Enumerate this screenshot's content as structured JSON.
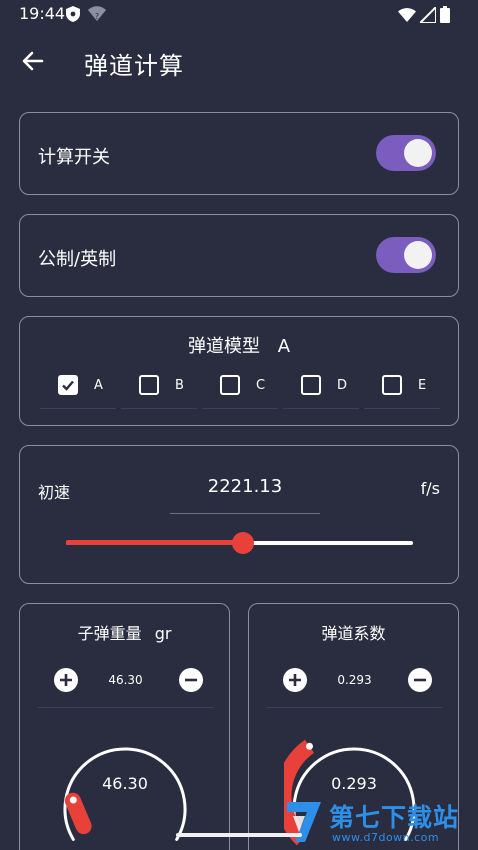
{
  "status": {
    "time": "19:44"
  },
  "header": {
    "title": "弹道计算"
  },
  "calc_switch": {
    "label": "计算开关",
    "on": true
  },
  "unit_switch": {
    "label": "公制/英制",
    "on": true
  },
  "model": {
    "title": "弹道模型",
    "selected": "A",
    "options": [
      {
        "label": "A",
        "checked": true
      },
      {
        "label": "B",
        "checked": false
      },
      {
        "label": "C",
        "checked": false
      },
      {
        "label": "D",
        "checked": false
      },
      {
        "label": "E",
        "checked": false
      }
    ]
  },
  "velocity": {
    "label": "初速",
    "value": "2221.13",
    "unit": "f/s",
    "slider_fraction": 0.51
  },
  "bullet_weight": {
    "title": "子弹重量",
    "unit": "gr",
    "stepper_value": "46.30",
    "gauge_value": "46.30"
  },
  "bc": {
    "title": "弹道系数",
    "stepper_value": "0.293",
    "gauge_value": "0.293"
  },
  "colors": {
    "background": "#2a2d40",
    "accent": "#e8413a",
    "toggle": "#7a5dbf",
    "border": "#8b8e9e"
  },
  "watermark": {
    "name": "第七下载站",
    "url": "www.d7down.com"
  }
}
